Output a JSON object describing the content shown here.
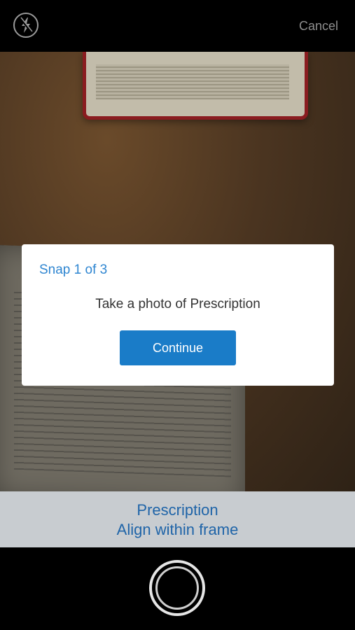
{
  "header": {
    "flash_icon": "flash-icon",
    "cancel_label": "Cancel"
  },
  "modal": {
    "step_text": "Snap 1 of 3",
    "message": "Take a photo of Prescription",
    "continue_label": "Continue"
  },
  "instruction": {
    "title": "Prescription",
    "subtitle": "Align within frame"
  },
  "footer": {
    "shutter_icon": "shutter-button-icon"
  },
  "colors": {
    "accent": "#1a7cc8",
    "link": "#2f86d1",
    "instruction_text": "#1f64a8"
  }
}
